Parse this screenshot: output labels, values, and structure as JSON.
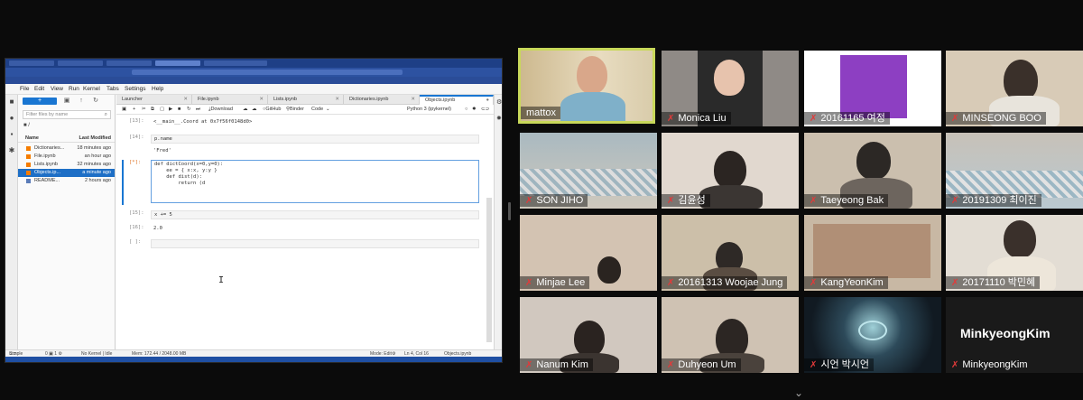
{
  "menu": [
    "File",
    "Edit",
    "View",
    "Run",
    "Kernel",
    "Tabs",
    "Settings",
    "Help"
  ],
  "file_browser": {
    "filter_placeholder": "Filter files by name",
    "header_name": "Name",
    "header_modified": "Last Modified",
    "files": [
      {
        "name": "Dictionaries...",
        "modified": "18 minutes ago"
      },
      {
        "name": "File.ipynb",
        "modified": "an hour ago"
      },
      {
        "name": "Lists.ipynb",
        "modified": "32 minutes ago"
      },
      {
        "name": "Objects.ip...",
        "modified": "a minute ago"
      },
      {
        "name": "README...",
        "modified": "2 hours ago"
      }
    ]
  },
  "doc_tabs": [
    "Launcher",
    "File.ipynb",
    "Lists.ipynb",
    "Dictionaries.ipynb",
    "Objects.ipynb"
  ],
  "notebook_toolbar": {
    "download": "Download",
    "github": "GitHub",
    "binder": "Binder",
    "cell_type": "Code",
    "kernel": "Python 3 (ipykernel)"
  },
  "cells": [
    {
      "prompt": "[13]:",
      "code": "",
      "output": "<__main__.Coord at 0x7f56f0148d0>"
    },
    {
      "prompt": "[14]:",
      "code": "p.name",
      "output": "'Fred'"
    },
    {
      "prompt": "[*]:",
      "code": "def dictCoord(x=0,y=0):\n    ee = { x:x, y:y }\n    def dist(d):\n        return (d",
      "output": ""
    },
    {
      "prompt": "[15]:",
      "code": "x += 5",
      "output": ""
    },
    {
      "prompt": "[16]:",
      "code": "",
      "output": "2.0"
    },
    {
      "prompt": "[ ]:",
      "code": "",
      "output": ""
    }
  ],
  "status_bar": {
    "mode_simple": "Simple",
    "kernel_status": "No Kernel | Idle",
    "mem": "Mem: 172.44 / 2048.00 MB",
    "edit_mode": "Mode: Edit",
    "cursor_pos": "Ln 4, Col 16",
    "file": "Objects.ipynb"
  },
  "participants": [
    {
      "name": "mattox",
      "muted": false,
      "speaking": true
    },
    {
      "name": "Monica Liu",
      "muted": true
    },
    {
      "name": "20161165 여정",
      "muted": true
    },
    {
      "name": "MINSEONG BOO",
      "muted": true
    },
    {
      "name": "SON JIHO",
      "muted": true
    },
    {
      "name": "김윤성",
      "muted": true
    },
    {
      "name": "Taeyeong Bak",
      "muted": true
    },
    {
      "name": "20191309 최이진",
      "muted": true
    },
    {
      "name": "Minjae Lee",
      "muted": true
    },
    {
      "name": "20161313 Woojae Jung",
      "muted": true
    },
    {
      "name": "KangYeonKim",
      "muted": true
    },
    {
      "name": "20171110 박민혜",
      "muted": true
    },
    {
      "name": "Nanum Kim",
      "muted": true
    },
    {
      "name": "Duhyeon Um",
      "muted": true
    },
    {
      "name": "시언 박시언",
      "muted": true
    },
    {
      "name": "MinkyeongKim",
      "muted": true
    }
  ],
  "no_video_name": "MinkyeongKim",
  "colors": {
    "speaking_border": "#c8d85a",
    "jupyter_blue": "#1976d2",
    "muted_mic": "#e23a3a"
  }
}
